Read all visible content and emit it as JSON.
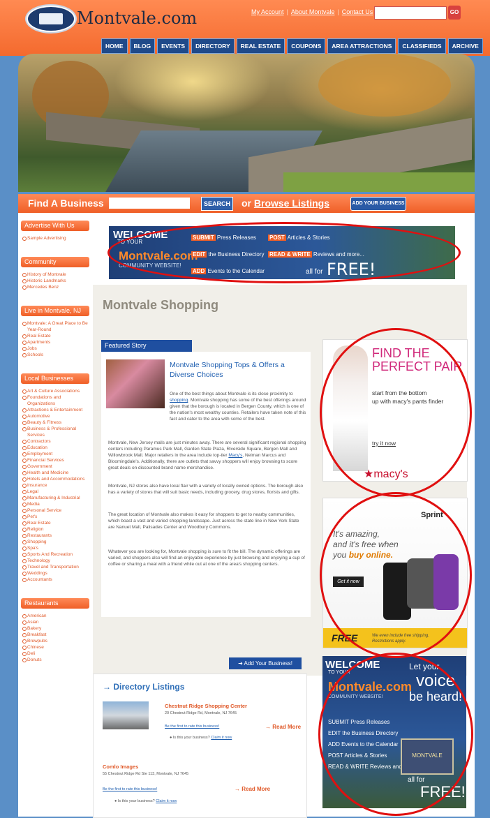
{
  "header": {
    "site_name": "Montvale.com",
    "top_links": [
      "My Account",
      "About Montvale",
      "Contact Us"
    ],
    "go_label": "GO",
    "nav": [
      "HOME",
      "BLOG",
      "EVENTS",
      "DIRECTORY",
      "REAL ESTATE",
      "COUPONS",
      "AREA ATTRACTIONS",
      "CLASSIFIEDS",
      "ARCHIVE"
    ]
  },
  "findbar": {
    "label": "Find A Business",
    "search_label": "SEARCH",
    "or_text": "or",
    "browse_label": "Browse Listings",
    "add_label": "ADD YOUR BUSINESS"
  },
  "sidebar": [
    {
      "title": "Advertise With Us",
      "items": [
        "Sample Advertising"
      ]
    },
    {
      "title": "Community",
      "items": [
        "History of Montvale",
        "Historic Landmarks",
        "Mercedes Benz"
      ]
    },
    {
      "title": "Live in Montvale, NJ",
      "items": [
        "Montvale: A Great Place to Be Year-Round",
        "Real Estate",
        "Apartments",
        "Jobs",
        "Schools"
      ]
    },
    {
      "title": "Local Businesses",
      "items": [
        "Art & Culture Associations",
        "Foundations and Organizations",
        "Attractions & Entertainment",
        "Automotive",
        "Beauty & Fitness",
        "Business & Professional Services",
        "Contractors",
        "Education",
        "Employment",
        "Financial Services",
        "Government",
        "Health and Medicine",
        "Hotels and Accommodations",
        "Insurance",
        "Legal",
        "Manufacturing & Industrial",
        "Media",
        "Personal Service",
        "Pet's",
        "Real Estate",
        "Religion",
        "Restaurants",
        "Shopping",
        "Spa's",
        "Sports And Recreation",
        "Technology",
        "Travel and Transportation",
        "Weddings",
        "Accountants"
      ]
    },
    {
      "title": "Restaurants",
      "items": [
        "American",
        "Asian",
        "Bakery",
        "Breakfast",
        "Brewpubs",
        "Chinese",
        "Deli",
        "Donuts"
      ]
    }
  ],
  "welcome_banner": {
    "welcome": "WELCOME",
    "to_your": "TO YOUR",
    "brand": "Montvale.com",
    "community": "COMMUNITY WEBSITE!",
    "lines": [
      {
        "tag": "SUBMIT",
        "text": "Press Releases"
      },
      {
        "tag": "POST",
        "text": "Articles & Stories"
      },
      {
        "tag": "EDIT",
        "text": "the Business Directory"
      },
      {
        "tag": "READ & WRITE",
        "text": "Reviews and more..."
      },
      {
        "tag": "ADD",
        "text": "Events to the Calendar"
      }
    ],
    "all_for": "all for",
    "free": "FREE!"
  },
  "main": {
    "page_title": "Montvale Shopping",
    "featured_label": "Featured Story",
    "article_title": "Montvale Shopping Tops & Offers a Diverse Choices",
    "p1a": "One of the best things about Montvale is its close proximity to",
    "p1_link": "shopping",
    "p1b": ". Montvale shopping has some of the best offerings around given that the borough is located in Bergen County, which is one of the nation's most wealthy counties. Retailers have taken note of this fact and cater to the area with some of the best.",
    "p2a": "Montvale, New Jersey malls are just minutes away. There are several significant regional shopping centers including Paramus Park Mall, Garden State Plaza, Riverside Square, Bergen Mall and Willowbrook Mall. Major retailers in the area include top-tier",
    "p2_link": "Macy's",
    "p2b": ", Neiman Marcus and Bloomingdale's. Additionally, there are outlets that savvy shoppers will enjoy browsing to score great deals on discounted brand name merchandise.",
    "p3": "Montvale, NJ stores also have local flair with a variety of locally owned options. The borough also has a variety of stores that will suit basic needs, including grocery, drug stores, florists and gifts.",
    "p4": "The great location of Montvale also makes it easy for shoppers to get to nearby communities, which boast a vast and varied shopping landscape. Just across the state line in New York State are Nanuet Mall, Palisades Center and Woodbury Commons.",
    "p5": "Whatever you are looking for, Montvale shopping is sure to fit the bill. The dynamic offerings are varied, and shoppers also will find an enjoyable experience by just browsing and enjoying a cup of coffee or sharing a meal with a friend while out at one of the area's shopping centers."
  },
  "ads": {
    "macys": {
      "line1": "FIND THE",
      "line2": "PERFECT PAIR",
      "sub1": "start from the bottom",
      "sub2": "up with macy's pants finder",
      "cta": "try it now",
      "brand": "★macy's"
    },
    "sprint": {
      "brand": "Sprint",
      "l1": "It's amazing,",
      "l2": "and it's free when",
      "l3a": "you",
      "l3b": "buy online.",
      "cta": "Get it now",
      "free": "FREE",
      "fine1": "We even include free shipping.",
      "fine2": "Restrictions apply."
    },
    "voice": {
      "welcome": "WELCOME",
      "to_your": "TO YOUR",
      "brand": "Montvale.com",
      "community": "COMMUNITY WEBSITE!",
      "let": "Let your",
      "voice": "voice",
      "heard": "be heard!",
      "lines": [
        "SUBMIT Press Releases",
        "EDIT the Business Directory",
        "ADD Events to the Calendar",
        "POST Articles & Stories",
        "READ & WRITE Reviews and more..."
      ],
      "sign": "MONTVALE",
      "all_for": "all for",
      "free": "FREE!"
    }
  },
  "directory": {
    "add_button": "Add Your Business!",
    "heading": "Directory Listings",
    "listings": [
      {
        "name": "Chestnut Ridge Shopping Center",
        "address": "20 Chestnut Ridge Rd, Montvale, NJ 7645",
        "rate": "Be the first to rate this business!",
        "claim_q": "Is this your business?",
        "claim": "Claim it now",
        "read_more": "Read More"
      },
      {
        "name": "Comlo Images",
        "address": "55 Chestnut Ridge Rd Ste 113, Montvale, NJ 7645",
        "rate": "Be the first to rate this business!",
        "claim_q": "Is this your business?",
        "claim": "Claim it now",
        "read_more": "Read More"
      }
    ]
  }
}
